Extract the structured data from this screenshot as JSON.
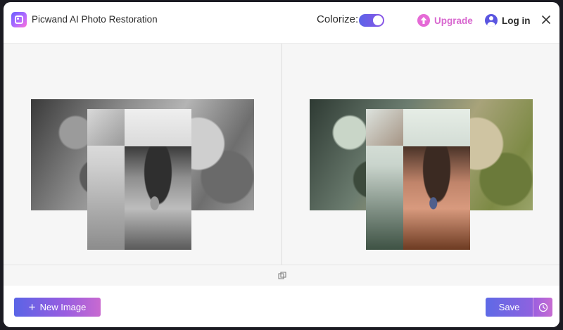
{
  "header": {
    "app_title": "Picwand AI Photo Restoration",
    "colorize_label": "Colorize:",
    "colorize_on": true,
    "upgrade_label": "Upgrade",
    "login_label": "Log in"
  },
  "icons": {
    "logo": "app-logo-icon",
    "upgrade": "upgrade-arrow-icon",
    "user": "user-icon",
    "close": "close-icon",
    "compare": "compare-icon",
    "plus": "plus-icon",
    "history": "history-clock-icon"
  },
  "footer": {
    "new_image_label": "New Image",
    "save_label": "Save"
  },
  "colors": {
    "accent_start": "#5a64e6",
    "accent_end": "#c86ad0",
    "upgrade": "#d867cf",
    "user": "#5a55e0"
  }
}
